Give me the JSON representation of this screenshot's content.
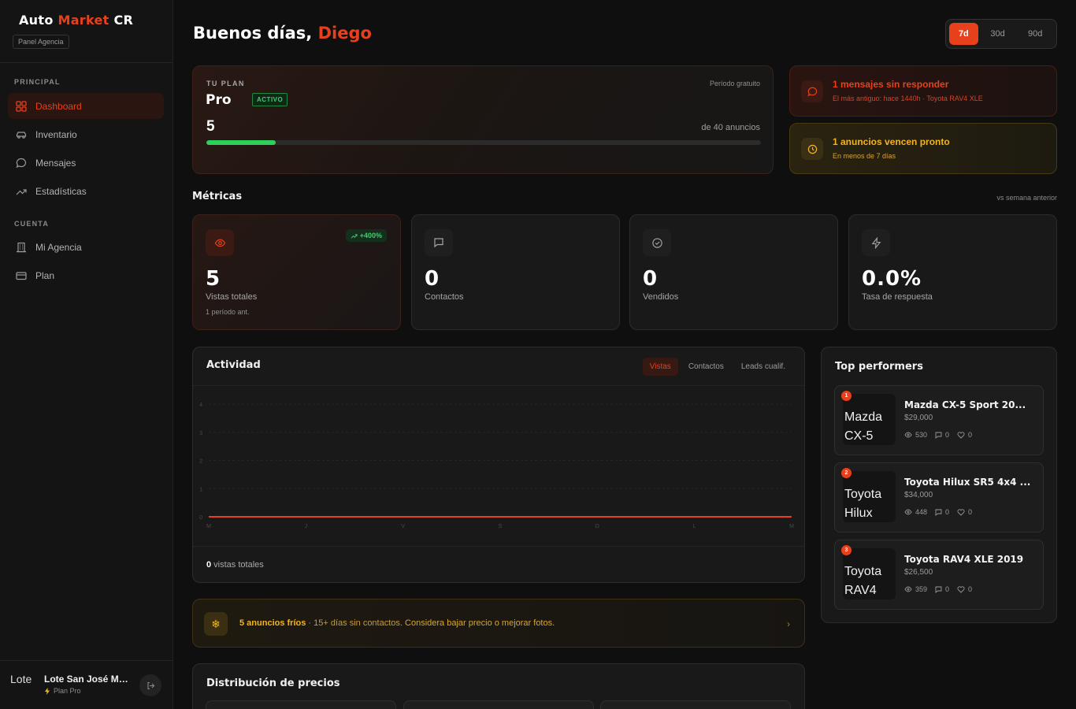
{
  "brand": {
    "part1": "Auto ",
    "part2": "Market",
    "part3": " CR",
    "badge": "Panel Agencia"
  },
  "sidebar": {
    "section_principal": "PRINCIPAL",
    "section_cuenta": "CUENTA",
    "items": [
      {
        "label": "Dashboard",
        "icon": "grid-icon"
      },
      {
        "label": "Inventario",
        "icon": "car-icon"
      },
      {
        "label": "Mensajes",
        "icon": "chat-icon"
      },
      {
        "label": "Estadísticas",
        "icon": "trend-icon"
      },
      {
        "label": "Mi Agencia",
        "icon": "building-icon"
      },
      {
        "label": "Plan",
        "icon": "card-icon"
      }
    ],
    "user": {
      "name": "Lote San José Mo...",
      "avatar_alt": "Lote",
      "plan": "Plan Pro"
    }
  },
  "header": {
    "greeting": "Buenos días, ",
    "name": "Diego"
  },
  "range": {
    "options": [
      "7d",
      "30d",
      "90d"
    ],
    "selected": "7d"
  },
  "plan": {
    "label": "TU PLAN",
    "period": "Período gratuito",
    "name": "Pro",
    "status": "ACTIVO",
    "used": "5",
    "limit_text": "de 40 anuncios",
    "progress": 0.125
  },
  "alerts": [
    {
      "title": "1 mensajes sin responder",
      "sub": "El más antiguo: hace 1440h · Toyota RAV4 XLE"
    },
    {
      "title": "1 anuncios vencen pronto",
      "sub": "En menos de 7 días"
    }
  ],
  "metrics_section": {
    "title": "Métricas",
    "note": "vs semana anterior"
  },
  "metrics": [
    {
      "value": "5",
      "label": "Vistas totales",
      "sub": "1 período ant.",
      "delta": "+400%",
      "icon": "eye-icon"
    },
    {
      "value": "0",
      "label": "Contactos",
      "icon": "message-icon"
    },
    {
      "value": "0",
      "label": "Vendidos",
      "icon": "check-circle-icon"
    },
    {
      "value": "0.0%",
      "label": "Tasa de respuesta",
      "icon": "bolt-icon"
    }
  ],
  "activity": {
    "title": "Actividad",
    "tabs": [
      "Vistas",
      "Contactos",
      "Leads cualif."
    ],
    "selected_tab": "Vistas",
    "total_value": "0",
    "total_label": " vistas totales"
  },
  "chart_data": {
    "type": "line",
    "categories": [
      "M",
      "J",
      "V",
      "S",
      "D",
      "L",
      "M"
    ],
    "series": [
      {
        "values": [
          0,
          0,
          0,
          0,
          0,
          0,
          0
        ]
      }
    ],
    "yticks": [
      "4",
      "3",
      "2",
      "1",
      "0"
    ],
    "ylim": [
      0,
      4
    ],
    "grid": true,
    "color": "#e8401c"
  },
  "cold": {
    "strong": "5 anuncios fríos",
    "middle": " · 15+ días sin contactos. ",
    "hint": "Considera bajar precio o mejorar fotos."
  },
  "distribution": {
    "title": "Distribución de precios"
  },
  "top": {
    "title": "Top performers",
    "items": [
      {
        "rank": "1",
        "thumb": "Mazda CX-5",
        "name": "Mazda CX-5 Sport 20...",
        "price": "$29,000",
        "views": "530",
        "messages": "0",
        "likes": "0"
      },
      {
        "rank": "2",
        "thumb": "Toyota Hilux",
        "name": "Toyota Hilux SR5 4x4 ...",
        "price": "$34,000",
        "views": "448",
        "messages": "0",
        "likes": "0"
      },
      {
        "rank": "3",
        "thumb": "Toyota RAV4",
        "name": "Toyota RAV4 XLE 2019",
        "price": "$26,500",
        "views": "359",
        "messages": "0",
        "likes": "0"
      }
    ]
  },
  "colors": {
    "accent": "#e8401c",
    "success": "#3ecf6a",
    "warning": "#f3b41c"
  }
}
